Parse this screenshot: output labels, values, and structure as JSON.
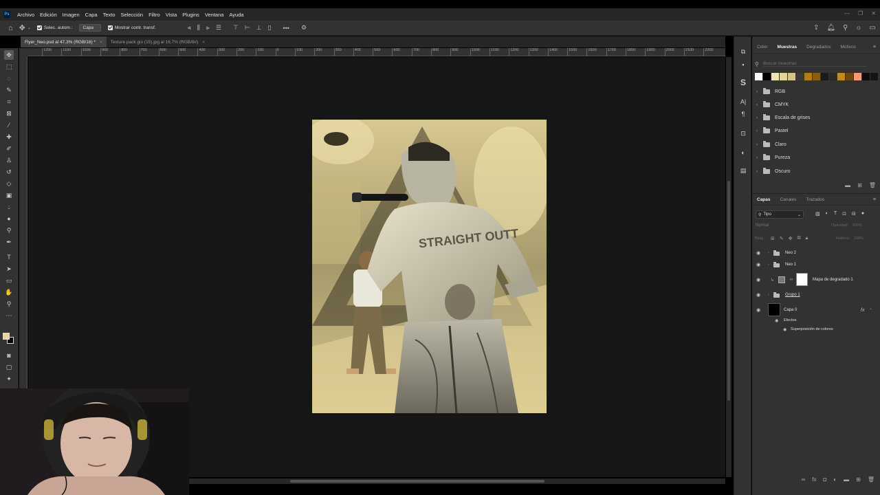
{
  "app": {
    "logo": "Ps",
    "menu": [
      "Archivo",
      "Edición",
      "Imagen",
      "Capa",
      "Texto",
      "Selección",
      "Filtro",
      "Vista",
      "Plugins",
      "Ventana",
      "Ayuda"
    ]
  },
  "options_bar": {
    "auto_select_label": "Selec. autom.:",
    "auto_select_target": "Capa",
    "show_transform_label": "Mostrar contr. transf."
  },
  "document_tabs": [
    {
      "label": "Flyer_Neo.psd al 47,3% (RGB/16) *",
      "active": true
    },
    {
      "label": "Texture pack gio (15).jpg al 16,7% (RGB/8#)",
      "active": false
    }
  ],
  "ruler_h_ticks": [
    "1200",
    "1100",
    "1000",
    "900",
    "800",
    "700",
    "600",
    "500",
    "400",
    "300",
    "200",
    "100",
    "0",
    "100",
    "200",
    "300",
    "400",
    "500",
    "600",
    "700",
    "800",
    "900",
    "1000",
    "1100",
    "1200",
    "1300",
    "1400",
    "1500",
    "1600",
    "1700",
    "1800",
    "1900",
    "2000",
    "2100",
    "2200"
  ],
  "swatches_panel": {
    "tabs": [
      "Color",
      "Muestras",
      "Degradados",
      "Motivos"
    ],
    "active_tab": "Muestras",
    "search_placeholder": "Buscar muestras",
    "recent_colors": [
      "#ffffff",
      "#000000",
      "#f1e4b2",
      "#e7d49c",
      "#d8c38a",
      "#3a3a3a",
      "#b07d1a",
      "#8a5c12",
      "#1a1a1a",
      "#2a2a2a",
      "#c08a28",
      "#6b4a10",
      "#f29a7a",
      "#0d0d0d",
      "#141414"
    ],
    "groups": [
      "RGB",
      "CMYK",
      "Escala de grises",
      "Pastel",
      "Claro",
      "Pureza",
      "Oscuro"
    ]
  },
  "layers_panel": {
    "tabs": [
      "Capas",
      "Canales",
      "Trazados"
    ],
    "active_tab": "Capas",
    "filter_label": "Tipo",
    "blend_mode": "Normal",
    "opacity_label": "Opacidad:",
    "opacity_value": "100%",
    "lock_label": "Bloq.:",
    "fill_label": "Relleno:",
    "fill_value": "100%",
    "layers": [
      {
        "name": "Neo 2",
        "kind": "group"
      },
      {
        "name": "Neo 1",
        "kind": "group"
      },
      {
        "name": "Mapa de degradado 1",
        "kind": "adjustment"
      },
      {
        "name": "Grupo 1",
        "kind": "group"
      },
      {
        "name": "Capa 0",
        "kind": "pixel",
        "fx": "fx"
      }
    ],
    "effects_label": "Efectos",
    "effect_name": "Superposición de colores"
  }
}
